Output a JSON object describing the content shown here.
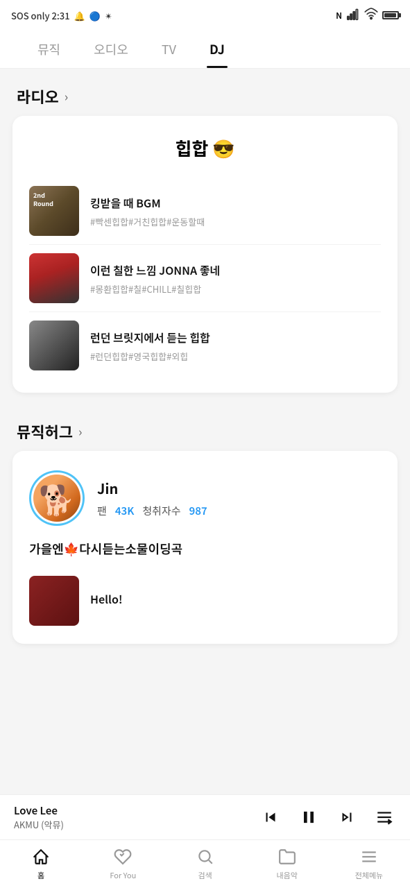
{
  "statusBar": {
    "left": "SOS only  2:31",
    "icons": [
      "bell",
      "vpn",
      "star",
      "nfc",
      "signal",
      "wifi",
      "battery"
    ]
  },
  "topNav": {
    "tabs": [
      {
        "id": "music",
        "label": "뮤직",
        "active": false
      },
      {
        "id": "audio",
        "label": "오디오",
        "active": false
      },
      {
        "id": "tv",
        "label": "TV",
        "active": false
      },
      {
        "id": "dj",
        "label": "DJ",
        "active": true
      }
    ]
  },
  "radioSection": {
    "title": "라디오",
    "arrow": ">",
    "card": {
      "title": "힙합 😎",
      "playlists": [
        {
          "name": "킹받을 때 BGM",
          "tags": "#빡센힙합#거친힙합#운동할때",
          "thumb": "thumb-1"
        },
        {
          "name": "이런 칠한 느낌 JONNA 좋네",
          "tags": "#몽환힙합#칠#CHILL#칠힙합",
          "thumb": "thumb-2"
        },
        {
          "name": "런던 브릿지에서 듣는 힙합",
          "tags": "#런던힙합#영국힙합#외힙",
          "thumb": "thumb-3"
        }
      ]
    }
  },
  "muzichugSection": {
    "title": "뮤직허그",
    "arrow": ">",
    "card": {
      "dj": {
        "name": "Jin",
        "fans_label": "팬",
        "fans_count": "43K",
        "listeners_label": "청취자수",
        "listeners_count": "987"
      },
      "postTitle": "가을엔🍁다시듣는소물이딩곡",
      "postThumb": "thumb-dj"
    }
  },
  "nowPlaying": {
    "title": "Love Lee",
    "artist": "AKMU (악뮤)"
  },
  "bottomNav": {
    "items": [
      {
        "id": "home",
        "label": "홈",
        "icon": "home",
        "active": true
      },
      {
        "id": "foryou",
        "label": "For You",
        "icon": "heart",
        "active": false
      },
      {
        "id": "search",
        "label": "검색",
        "icon": "search",
        "active": false
      },
      {
        "id": "mylibrary",
        "label": "내음악",
        "icon": "folder",
        "active": false
      },
      {
        "id": "menu",
        "label": "전체메뉴",
        "icon": "menu",
        "active": false
      }
    ]
  }
}
